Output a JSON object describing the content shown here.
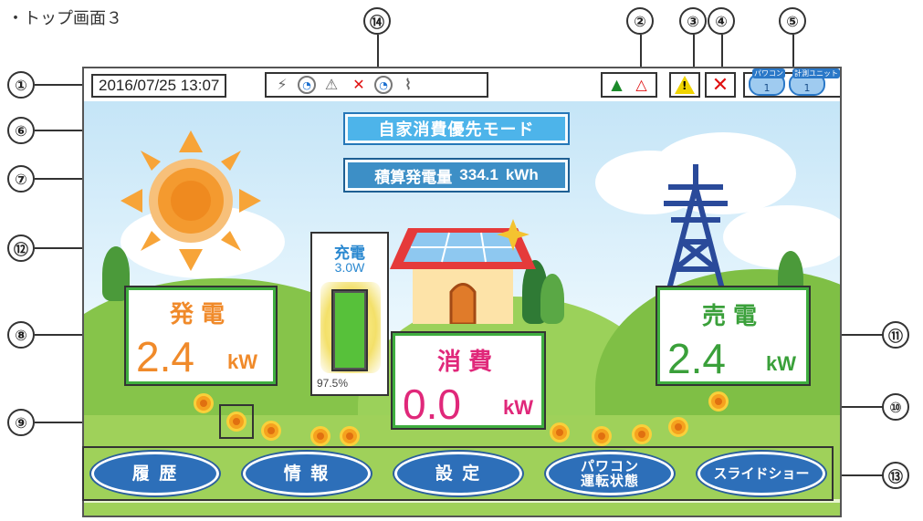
{
  "caption": "・トップ画面３",
  "callouts": [
    "①",
    "②",
    "③",
    "④",
    "⑤",
    "⑥",
    "⑦",
    "⑧",
    "⑨",
    "⑩",
    "⑪",
    "⑫",
    "⑬",
    "⑭"
  ],
  "status": {
    "datetime": "2016/07/25 13:07",
    "icons_group14": [
      "pole-network-icon",
      "clock-network-icon",
      "pole-warning-icon",
      "pole-error-icon",
      "clock-warning-icon",
      "tower-clock-icon"
    ],
    "icons_group2": [
      "grid-warning-icon",
      "heat-warning-icon"
    ],
    "badges": [
      {
        "tag": "パワコン",
        "count": "1"
      },
      {
        "tag": "計測ユニット",
        "count": "1"
      }
    ]
  },
  "mode": "自家消費優先モード",
  "total": {
    "label": "積算発電量",
    "value": "334.1",
    "unit": "kWh"
  },
  "generation": {
    "title": "発電",
    "value": "2.4",
    "unit": "kW"
  },
  "consumption": {
    "title": "消費",
    "value": "0.0",
    "unit": "kW"
  },
  "sell": {
    "title": "売電",
    "value": "2.4",
    "unit": "kW"
  },
  "battery": {
    "label": "充電",
    "power": "3.0W",
    "level": "97.5%",
    "level_fraction": 0.975
  },
  "buttons": {
    "history": "履 歴",
    "info": "情 報",
    "settings": "設 定",
    "pcs_line1": "パワコン",
    "pcs_line2": "運転状態",
    "slideshow": "スライドショー"
  },
  "colors": {
    "generation": "#f08a2a",
    "consumption": "#e0287a",
    "sell": "#3aa03a",
    "button": "#2d6fb9",
    "mode": "#4db4ea"
  }
}
